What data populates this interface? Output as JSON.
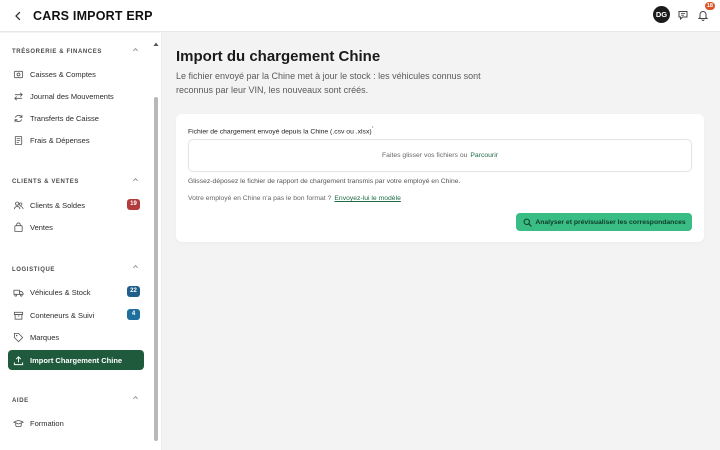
{
  "header": {
    "title": "CARS IMPORT ERP",
    "avatar_initials": "DG",
    "notification_count": "18"
  },
  "sidebar": {
    "sections": [
      {
        "title": "TRÉSORERIE & FINANCES"
      },
      {
        "title": "CLIENTS & VENTES"
      },
      {
        "title": "LOGISTIQUE"
      },
      {
        "title": "AIDE"
      }
    ],
    "items": [
      {
        "label": "Caisses & Comptes",
        "icon": "cash-register-icon"
      },
      {
        "label": "Journal des Mouvements",
        "icon": "arrows-swap-icon"
      },
      {
        "label": "Transferts de Caisse",
        "icon": "refresh-icon"
      },
      {
        "label": "Frais & Dépenses",
        "icon": "receipt-icon"
      },
      {
        "label": "Clients & Soldes",
        "icon": "users-icon",
        "badge": "19",
        "badge_color": "#b23b3b"
      },
      {
        "label": "Ventes",
        "icon": "shopping-bag-icon"
      },
      {
        "label": "Véhicules & Stock",
        "icon": "truck-icon",
        "badge": "22",
        "badge_color": "#1f5f8c"
      },
      {
        "label": "Conteneurs & Suivi",
        "icon": "box-icon",
        "badge": "4",
        "badge_color": "#1f6f9e"
      },
      {
        "label": "Marques",
        "icon": "tag-icon"
      },
      {
        "label": "Import Chargement Chine",
        "icon": "upload-icon",
        "active": true
      },
      {
        "label": "Formation",
        "icon": "graduation-cap-icon"
      }
    ]
  },
  "main": {
    "title": "Import du chargement Chine",
    "description": "Le fichier envoyé par la Chine met à jour le stock : les véhicules connus sont reconnus par leur VIN, les nouveaux sont créés.",
    "field_label": "Fichier de chargement envoyé depuis la Chine (.csv ou .xlsx)",
    "required_mark": "*",
    "dropzone_text": "Faites glisser vos fichiers ou",
    "dropzone_link": "Parcourir",
    "hint": "Glissez-déposez le fichier de rapport de chargement transmis par votre employé en Chine.",
    "format_question": "Votre employé en Chine n'a pas le bon format ?",
    "format_link": "Envoyez-lui le modèle",
    "analyze_button": "Analyser et prévisualiser les correspondances"
  },
  "colors": {
    "accent": "#1f5a3c",
    "button": "#39bd84",
    "link": "#1d6b48"
  }
}
